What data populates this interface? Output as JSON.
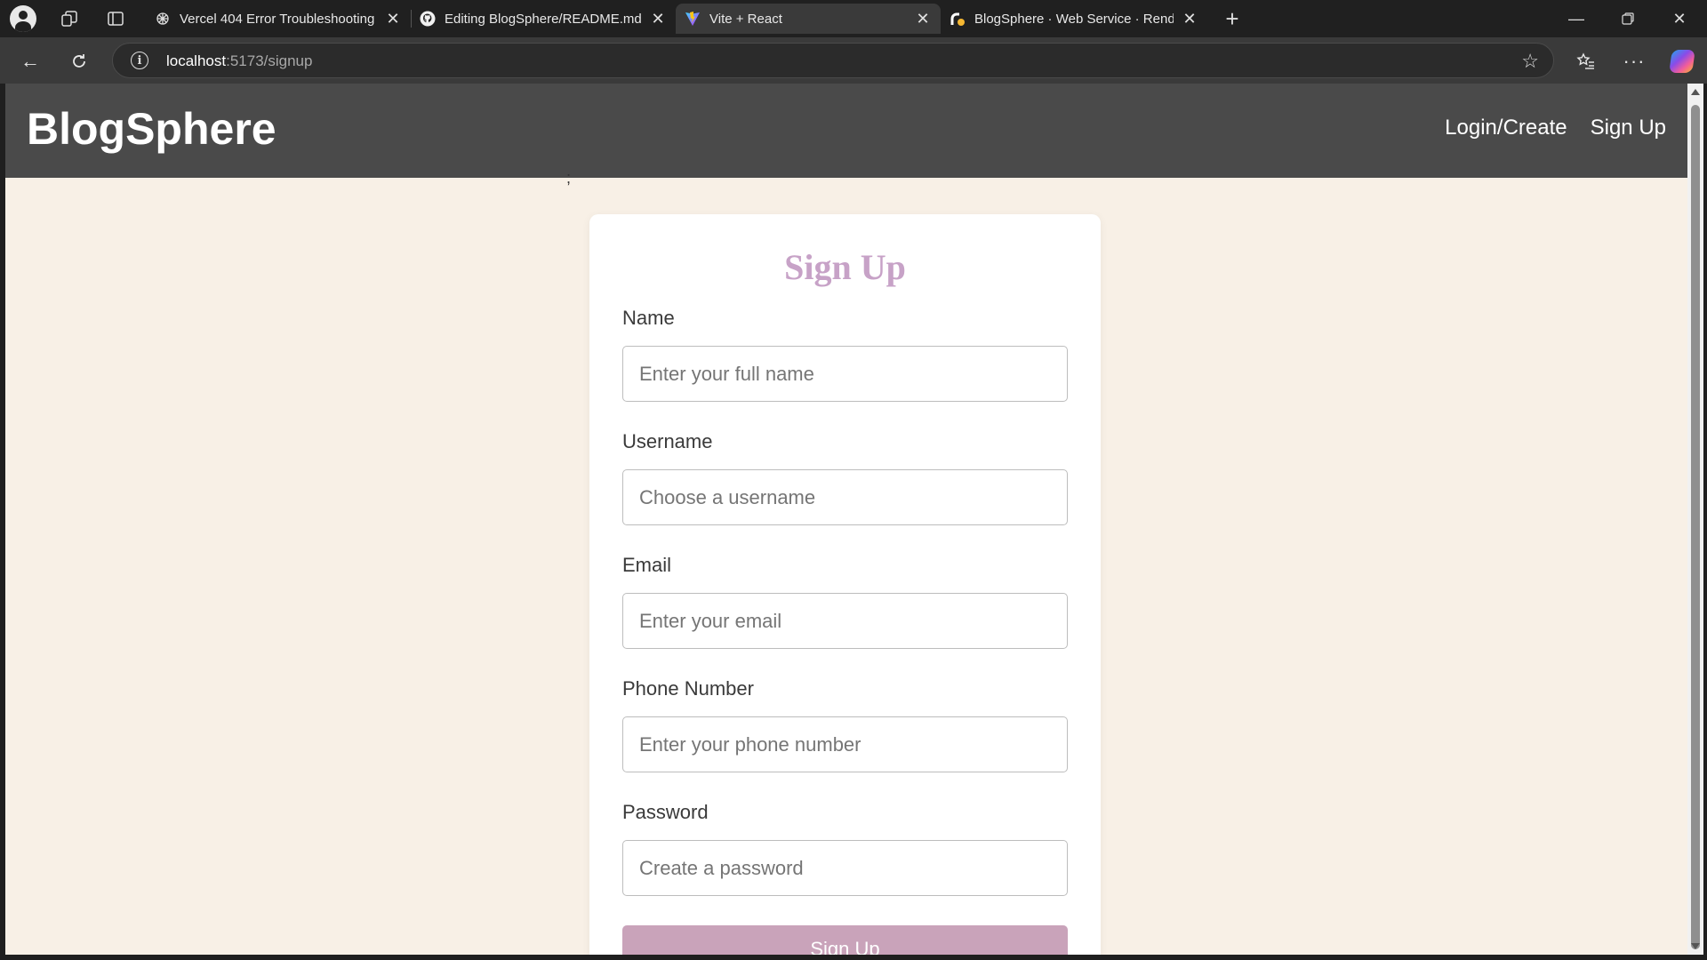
{
  "browser": {
    "tabs": [
      {
        "title": "Vercel 404 Error Troubleshooting",
        "favicon": "chatgpt-icon"
      },
      {
        "title": "Editing BlogSphere/README.md a",
        "favicon": "github-icon"
      },
      {
        "title": "Vite + React",
        "favicon": "vite-icon"
      },
      {
        "title": "BlogSphere · Web Service · Rend",
        "favicon": "render-icon"
      }
    ],
    "active_tab": 2,
    "address": {
      "host": "localhost",
      "path": ":5173/signup"
    }
  },
  "site": {
    "logo": "BlogSphere",
    "nav": {
      "login": "Login/Create",
      "signup": "Sign Up"
    },
    "stray_char": ";"
  },
  "form": {
    "title": "Sign Up",
    "fields": {
      "name": {
        "label": "Name",
        "placeholder": "Enter your full name"
      },
      "username": {
        "label": "Username",
        "placeholder": "Choose a username"
      },
      "email": {
        "label": "Email",
        "placeholder": "Enter your email"
      },
      "phone": {
        "label": "Phone Number",
        "placeholder": "Enter your phone number"
      },
      "password": {
        "label": "Password",
        "placeholder": "Create a password"
      }
    },
    "submit_label": "Sign Up"
  },
  "colors": {
    "page_bg": "#f8f0e6",
    "header_bg": "#4a4a4a",
    "title_color": "#c7a2c7",
    "button_bg": "#c9a3ba"
  }
}
